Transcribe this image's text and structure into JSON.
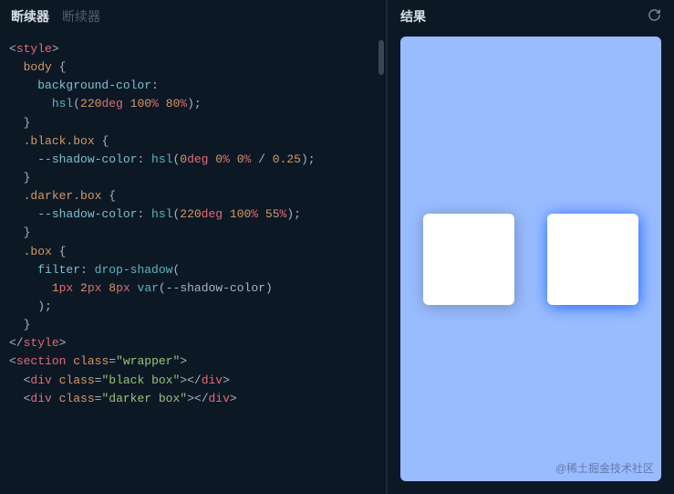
{
  "tabs": {
    "active": "断续器",
    "inactive": "断续器"
  },
  "result": {
    "title": "结果"
  },
  "code": {
    "l1": {
      "a": "<",
      "b": "style",
      "c": ">"
    },
    "l2": {
      "a": "  ",
      "sel": "body",
      "b": " {"
    },
    "l3": {
      "a": "    ",
      "prop": "background-color",
      "b": ":"
    },
    "l4": {
      "a": "      ",
      "fn": "hsl",
      "b": "(",
      "n1": "220",
      "u1": "deg",
      "sp1": " ",
      "n2": "100",
      "u2": "%",
      "sp2": " ",
      "n3": "80",
      "u3": "%",
      "c": ");"
    },
    "l5": {
      "a": "  }"
    },
    "l6": {
      "a": ""
    },
    "l7": {
      "a": "  ",
      "s1": ".black",
      "s2": ".box",
      "b": " {"
    },
    "l8": {
      "a": "    ",
      "prop": "--shadow-color",
      "b": ": ",
      "fn": "hsl",
      "c": "(",
      "n1": "0",
      "u1": "deg",
      "sp1": " ",
      "n2": "0",
      "u2": "%",
      "sp2": " ",
      "n3": "0",
      "u3": "%",
      "sp3": " / ",
      "n4": "0.25",
      "d": ");"
    },
    "l9": {
      "a": "  }"
    },
    "l10": {
      "a": "  ",
      "s1": ".darker",
      "s2": ".box",
      "b": " {"
    },
    "l11": {
      "a": "    ",
      "prop": "--shadow-color",
      "b": ": ",
      "fn": "hsl",
      "c": "(",
      "n1": "220",
      "u1": "deg",
      "sp1": " ",
      "n2": "100",
      "u2": "%",
      "sp2": " ",
      "n3": "55",
      "u3": "%",
      "d": ");"
    },
    "l12": {
      "a": "  }"
    },
    "l13": {
      "a": "  ",
      "s1": ".box",
      "b": " {"
    },
    "l14": {
      "a": "    ",
      "prop": "filter",
      "b": ": ",
      "fn": "drop-shadow",
      "c": "("
    },
    "l15": {
      "a": "      ",
      "n1": "1",
      "u1": "px",
      "sp1": " ",
      "n2": "2",
      "u2": "px",
      "sp2": " ",
      "n3": "8",
      "u3": "px",
      "sp3": " ",
      "fn": "var",
      "b": "(--shadow-color)"
    },
    "l16": {
      "a": "    );"
    },
    "l17": {
      "a": "  }"
    },
    "l18": {
      "a": "</",
      "b": "style",
      "c": ">"
    },
    "l19": {
      "a": ""
    },
    "l20": {
      "a": "<",
      "tag": "section",
      "sp": " ",
      "attr": "class",
      "eq": "=",
      "q1": "\"",
      "val": "wrapper",
      "q2": "\"",
      "c": ">"
    },
    "l21": {
      "a": "  <",
      "tag": "div",
      "sp": " ",
      "attr": "class",
      "eq": "=",
      "q1": "\"",
      "val": "black box",
      "q2": "\"",
      "c": "></",
      "tag2": "div",
      "d": ">"
    },
    "l22": {
      "a": "  <",
      "tag": "div",
      "sp": " ",
      "attr": "class",
      "eq": "=",
      "q1": "\"",
      "val": "darker box",
      "q2": "\"",
      "c": "></",
      "tag2": "div",
      "d": ">"
    }
  },
  "watermark": "@稀土掘金技术社区"
}
